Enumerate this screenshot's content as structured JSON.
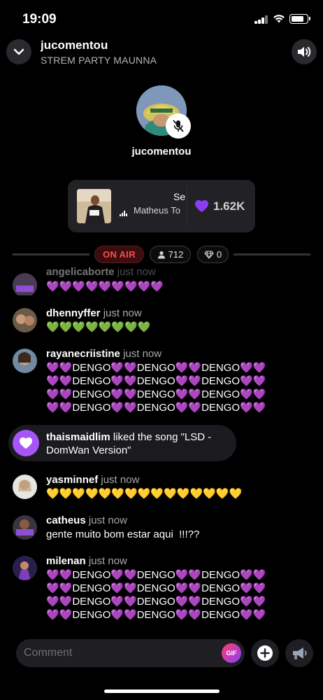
{
  "status_bar": {
    "time": "19:09"
  },
  "header": {
    "title": "jucomentou",
    "subtitle": "STREM PARTY MAUNNA",
    "collapse_icon": "chevron-down-icon",
    "volume_icon": "speaker-icon"
  },
  "host": {
    "name": "jucomentou",
    "mic_state": "muted"
  },
  "now_playing": {
    "title": "Se",
    "artist": "Matheus To",
    "likes": "1.62K"
  },
  "live_stats": {
    "on_air_label": "ON AIR",
    "listeners": "712",
    "gems": "0"
  },
  "chat": {
    "partial": {
      "user": "angelicaborte",
      "time": "just now",
      "message": "💜💜💜💜💜💜💜💜💜"
    },
    "messages": [
      {
        "user": "dhennyffer",
        "time": "just now",
        "message": "💚💚💚💚💚💚💚💚"
      },
      {
        "user": "rayanecriistine",
        "time": "just now",
        "message": "💜💜DENGO💜💜DENGO💜💜DENGO💜💜\n💜💜DENGO💜💜DENGO💜💜DENGO💜💜\n💜💜DENGO💜💜DENGO💜💜DENGO💜💜\n💜💜DENGO💜💜DENGO💜💜DENGO💜💜"
      },
      {
        "user": "yasminnef",
        "time": "just now",
        "message": "💛💛💛💛💛💛💛💛💛💛💛💛💛💛💛"
      },
      {
        "user": "catheus",
        "time": "just now",
        "message": "gente muito bom estar aqui  !!!??"
      },
      {
        "user": "milenan",
        "time": "just now",
        "message": "💜💜DENGO💜💜DENGO💜💜DENGO💜💜\n💜💜DENGO💜💜DENGO💜💜DENGO💜💜\n💜💜DENGO💜💜DENGO💜💜DENGO💜💜\n💜💜DENGO💜💜DENGO💜💜DENGO💜💜"
      }
    ],
    "liked_event": {
      "user": "thaismaidlim",
      "text": " liked the song \"LSD - DomWan Version\""
    }
  },
  "composer": {
    "placeholder": "Comment",
    "gif_label": "GIF"
  },
  "colors": {
    "accent_purple": "#a855f7",
    "on_air_red": "#ff4a4a",
    "background": "#000000"
  }
}
